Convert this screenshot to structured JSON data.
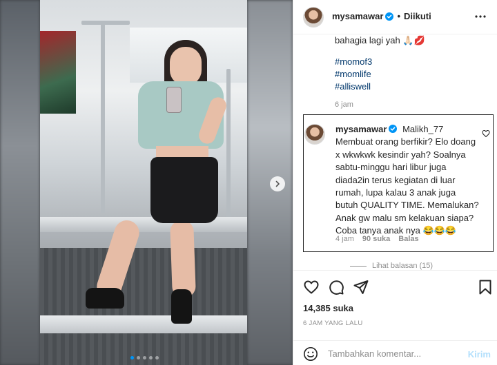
{
  "post": {
    "author": "mysamawar",
    "follow_status": "Diikuti",
    "separator": "•",
    "caption_line": "bahagia lagi yah 🙏🏻💋",
    "hashtags": [
      "#momof3",
      "#momlife",
      "#alliswell"
    ],
    "caption_time": "6 jam",
    "likes": "14,385 suka",
    "posted": "6 JAM YANG LALU",
    "carousel": {
      "slide_count": 5,
      "active_index": 0
    }
  },
  "comment": {
    "author": "mysamawar",
    "text": "Malikh_77 Membuat orang berfikir? Elo doang x wkwkwk kesindir yah? Soalnya sabtu-minggu hari libur juga diada2in terus kegiatan di luar rumah, lupa kalau 3 anak juga butuh QUALITY TIME. Memalukan? Anak gw malu sm kelakuan siapa? Coba tanya anak nya 😂😂😂",
    "time": "4 jam",
    "likes": "90 suka",
    "reply": "Balas"
  },
  "replies_label": "Lihat balasan (15)",
  "composer": {
    "placeholder": "Tambahkan komentar...",
    "post_label": "Kirim"
  },
  "colors": {
    "verified": "#0095f6",
    "link": "#00376b",
    "secondary_text": "#8e8e8e",
    "post_button_disabled": "#b2dffc"
  },
  "icons": [
    "verified-icon",
    "more-options-icon",
    "heart-icon",
    "comment-icon",
    "share-icon",
    "bookmark-icon",
    "emoji-icon",
    "chevron-right-icon"
  ]
}
